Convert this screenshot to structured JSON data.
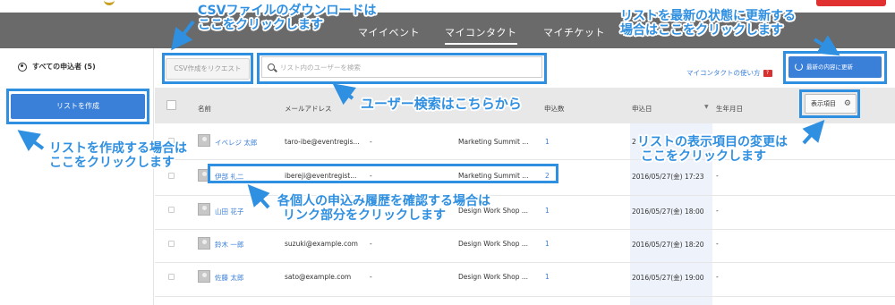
{
  "nav": {
    "tabs": [
      {
        "label": "マイイベント"
      },
      {
        "label": "マイコンタクト"
      },
      {
        "label": "マイチケット"
      }
    ]
  },
  "sidebar": {
    "all_applicants": "すべての申込者 (5)",
    "create_list_button": "リストを作成"
  },
  "toolbar": {
    "csv_button": "CSV作成をリクエスト",
    "search_placeholder": "リスト内のユーザーを検索",
    "help_link": "マイコンタクトの使い方",
    "help_badge": "?",
    "update_button": "最新の内容に更新"
  },
  "table": {
    "columns": [
      "名前",
      "メールアドレス",
      "申込数",
      "申込日",
      "生年月日"
    ],
    "display_items_button": "表示項目",
    "rows": [
      {
        "name": "イベレジ 太郎",
        "email": "taro-ibe@eventregis...",
        "email_extra": "-",
        "event": "Marketing Summit ...",
        "count": "1",
        "date": "2",
        "birth": ""
      },
      {
        "name": "伊部 礼二",
        "email": "ibereji@eventregist...",
        "email_extra": "-",
        "event": "Marketing Summit ...",
        "count": "2",
        "date": "2016/05/27(金) 17:23",
        "birth": "-"
      },
      {
        "name": "山田 花子",
        "email": "",
        "email_extra": "",
        "event": "Design Work Shop ...",
        "count": "1",
        "date": "2016/05/27(金) 18:00",
        "birth": "-"
      },
      {
        "name": "鈴木 一郎",
        "email": "suzuki@example.com",
        "email_extra": "-",
        "event": "Design Work Shop ...",
        "count": "1",
        "date": "2016/05/27(金) 18:20",
        "birth": "-"
      },
      {
        "name": "佐藤 太郎",
        "email": "sato@example.com",
        "email_extra": "-",
        "event": "Design Work Shop ...",
        "count": "1",
        "date": "2016/05/27(金) 19:00",
        "birth": "-"
      }
    ]
  },
  "annotations": {
    "csv": [
      "CSVファイルのダウンロードは",
      "ここをクリックします"
    ],
    "update": [
      "リストを最新の状態に更新する",
      "場合はここをクリックします"
    ],
    "search": "ユーザー検索はこちらから",
    "create_list": [
      "リストを作成する場合は",
      "ここをクリックします"
    ],
    "display_items": [
      "リストの表示項目の変更は",
      "ここをクリックします"
    ],
    "history": [
      "各個人の申込み履歴を確認する場合は",
      "リンク部分をクリックします"
    ]
  },
  "colors": {
    "nav_bg": "#6a6a6a",
    "primary_button": "#3a7fd8",
    "annotation": "#2f8fe0",
    "badge_red": "#d93030"
  }
}
